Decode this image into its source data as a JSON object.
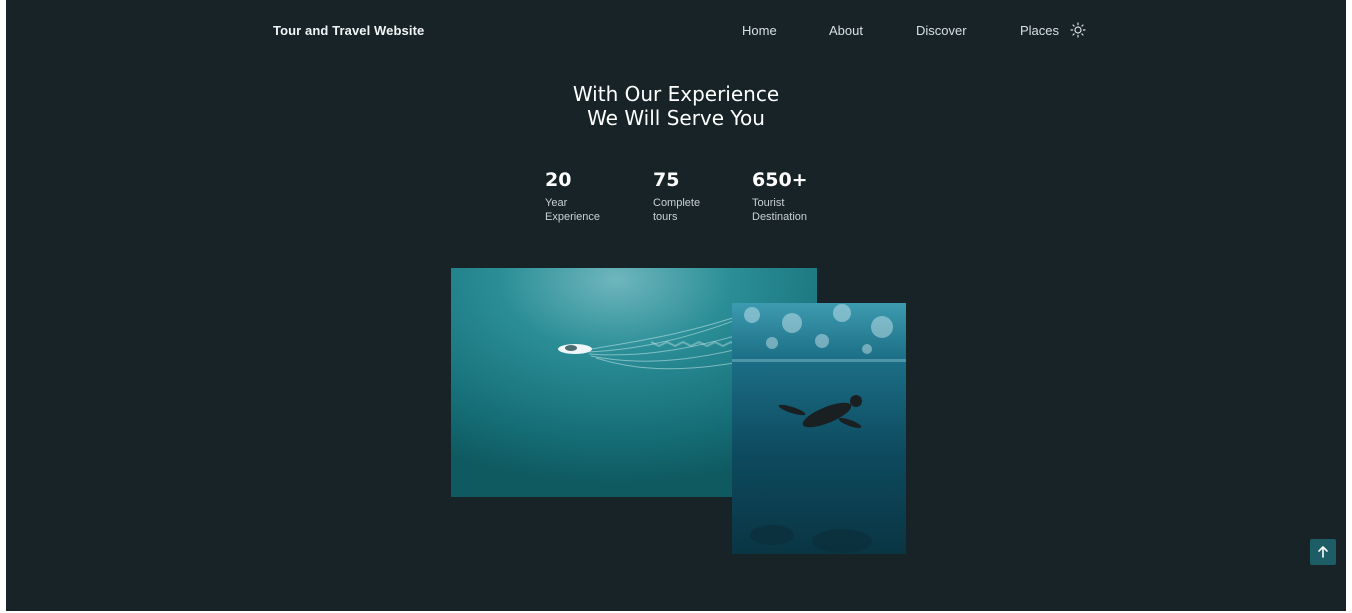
{
  "header": {
    "logo": "Tour and Travel Website",
    "nav": [
      {
        "label": "Home"
      },
      {
        "label": "About"
      },
      {
        "label": "Discover"
      },
      {
        "label": "Places"
      }
    ],
    "theme_icon": "sun-icon"
  },
  "hero": {
    "title_line1": "With Our Experience",
    "title_line2": "We Will Serve You"
  },
  "stats": [
    {
      "number": "20",
      "label_line1": "Year",
      "label_line2": "Experience"
    },
    {
      "number": "75",
      "label_line1": "Complete",
      "label_line2": "tours"
    },
    {
      "number": "650+",
      "label_line1": "Tourist",
      "label_line2": "Destination"
    }
  ],
  "images": {
    "large": "boat-on-ocean-image",
    "small": "underwater-diver-image"
  },
  "scroll_up_icon": "arrow-up-icon",
  "colors": {
    "background": "#172327",
    "accent": "#1c5d66",
    "text": "#ffffff"
  }
}
